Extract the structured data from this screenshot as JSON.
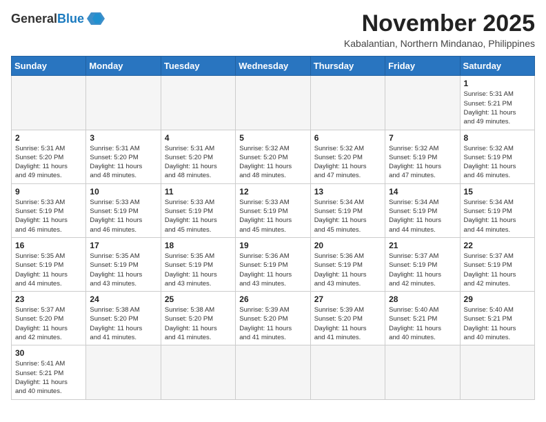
{
  "header": {
    "logo_general": "General",
    "logo_blue": "Blue",
    "month_title": "November 2025",
    "location": "Kabalantian, Northern Mindanao, Philippines"
  },
  "days_of_week": [
    "Sunday",
    "Monday",
    "Tuesday",
    "Wednesday",
    "Thursday",
    "Friday",
    "Saturday"
  ],
  "weeks": [
    [
      {
        "day": "",
        "info": ""
      },
      {
        "day": "",
        "info": ""
      },
      {
        "day": "",
        "info": ""
      },
      {
        "day": "",
        "info": ""
      },
      {
        "day": "",
        "info": ""
      },
      {
        "day": "",
        "info": ""
      },
      {
        "day": "1",
        "info": "Sunrise: 5:31 AM\nSunset: 5:21 PM\nDaylight: 11 hours\nand 49 minutes."
      }
    ],
    [
      {
        "day": "2",
        "info": "Sunrise: 5:31 AM\nSunset: 5:20 PM\nDaylight: 11 hours\nand 49 minutes."
      },
      {
        "day": "3",
        "info": "Sunrise: 5:31 AM\nSunset: 5:20 PM\nDaylight: 11 hours\nand 48 minutes."
      },
      {
        "day": "4",
        "info": "Sunrise: 5:31 AM\nSunset: 5:20 PM\nDaylight: 11 hours\nand 48 minutes."
      },
      {
        "day": "5",
        "info": "Sunrise: 5:32 AM\nSunset: 5:20 PM\nDaylight: 11 hours\nand 48 minutes."
      },
      {
        "day": "6",
        "info": "Sunrise: 5:32 AM\nSunset: 5:20 PM\nDaylight: 11 hours\nand 47 minutes."
      },
      {
        "day": "7",
        "info": "Sunrise: 5:32 AM\nSunset: 5:19 PM\nDaylight: 11 hours\nand 47 minutes."
      },
      {
        "day": "8",
        "info": "Sunrise: 5:32 AM\nSunset: 5:19 PM\nDaylight: 11 hours\nand 46 minutes."
      }
    ],
    [
      {
        "day": "9",
        "info": "Sunrise: 5:33 AM\nSunset: 5:19 PM\nDaylight: 11 hours\nand 46 minutes."
      },
      {
        "day": "10",
        "info": "Sunrise: 5:33 AM\nSunset: 5:19 PM\nDaylight: 11 hours\nand 46 minutes."
      },
      {
        "day": "11",
        "info": "Sunrise: 5:33 AM\nSunset: 5:19 PM\nDaylight: 11 hours\nand 45 minutes."
      },
      {
        "day": "12",
        "info": "Sunrise: 5:33 AM\nSunset: 5:19 PM\nDaylight: 11 hours\nand 45 minutes."
      },
      {
        "day": "13",
        "info": "Sunrise: 5:34 AM\nSunset: 5:19 PM\nDaylight: 11 hours\nand 45 minutes."
      },
      {
        "day": "14",
        "info": "Sunrise: 5:34 AM\nSunset: 5:19 PM\nDaylight: 11 hours\nand 44 minutes."
      },
      {
        "day": "15",
        "info": "Sunrise: 5:34 AM\nSunset: 5:19 PM\nDaylight: 11 hours\nand 44 minutes."
      }
    ],
    [
      {
        "day": "16",
        "info": "Sunrise: 5:35 AM\nSunset: 5:19 PM\nDaylight: 11 hours\nand 44 minutes."
      },
      {
        "day": "17",
        "info": "Sunrise: 5:35 AM\nSunset: 5:19 PM\nDaylight: 11 hours\nand 43 minutes."
      },
      {
        "day": "18",
        "info": "Sunrise: 5:35 AM\nSunset: 5:19 PM\nDaylight: 11 hours\nand 43 minutes."
      },
      {
        "day": "19",
        "info": "Sunrise: 5:36 AM\nSunset: 5:19 PM\nDaylight: 11 hours\nand 43 minutes."
      },
      {
        "day": "20",
        "info": "Sunrise: 5:36 AM\nSunset: 5:19 PM\nDaylight: 11 hours\nand 43 minutes."
      },
      {
        "day": "21",
        "info": "Sunrise: 5:37 AM\nSunset: 5:19 PM\nDaylight: 11 hours\nand 42 minutes."
      },
      {
        "day": "22",
        "info": "Sunrise: 5:37 AM\nSunset: 5:19 PM\nDaylight: 11 hours\nand 42 minutes."
      }
    ],
    [
      {
        "day": "23",
        "info": "Sunrise: 5:37 AM\nSunset: 5:20 PM\nDaylight: 11 hours\nand 42 minutes."
      },
      {
        "day": "24",
        "info": "Sunrise: 5:38 AM\nSunset: 5:20 PM\nDaylight: 11 hours\nand 41 minutes."
      },
      {
        "day": "25",
        "info": "Sunrise: 5:38 AM\nSunset: 5:20 PM\nDaylight: 11 hours\nand 41 minutes."
      },
      {
        "day": "26",
        "info": "Sunrise: 5:39 AM\nSunset: 5:20 PM\nDaylight: 11 hours\nand 41 minutes."
      },
      {
        "day": "27",
        "info": "Sunrise: 5:39 AM\nSunset: 5:20 PM\nDaylight: 11 hours\nand 41 minutes."
      },
      {
        "day": "28",
        "info": "Sunrise: 5:40 AM\nSunset: 5:21 PM\nDaylight: 11 hours\nand 40 minutes."
      },
      {
        "day": "29",
        "info": "Sunrise: 5:40 AM\nSunset: 5:21 PM\nDaylight: 11 hours\nand 40 minutes."
      }
    ],
    [
      {
        "day": "30",
        "info": "Sunrise: 5:41 AM\nSunset: 5:21 PM\nDaylight: 11 hours\nand 40 minutes."
      },
      {
        "day": "",
        "info": ""
      },
      {
        "day": "",
        "info": ""
      },
      {
        "day": "",
        "info": ""
      },
      {
        "day": "",
        "info": ""
      },
      {
        "day": "",
        "info": ""
      },
      {
        "day": "",
        "info": ""
      }
    ]
  ]
}
